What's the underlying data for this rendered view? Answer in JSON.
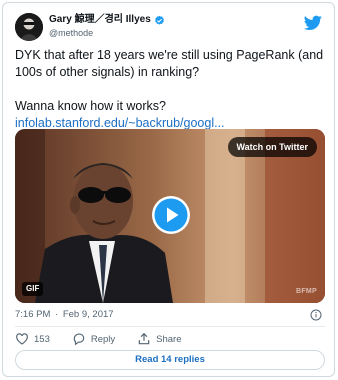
{
  "author": {
    "name": "Gary 鯨理／경리 Illyes",
    "handle": "@methode",
    "verified_color": "#1d9bf0"
  },
  "platform_icon": "twitter-bird-icon",
  "tweet": {
    "line1": "DYK that after 18 years we're still using PageRank (and 100s of other signals) in ranking?",
    "line2": "Wanna know how it works?",
    "link": "infolab.stanford.edu/~backrub/googl..."
  },
  "media": {
    "watch_label": "Watch on Twitter",
    "gif_label": "GIF",
    "watermark": "BFMP",
    "play_icon": "play-icon",
    "play_color": "#1d9bf0"
  },
  "meta": {
    "time": "7:16 PM",
    "date": "Feb 9, 2017",
    "info_icon": "info-icon"
  },
  "actions": {
    "like_count": "153",
    "like_icon": "heart-icon",
    "reply_label": "Reply",
    "reply_icon": "reply-icon",
    "share_label": "Share",
    "share_icon": "share-icon"
  },
  "read_replies_label": "Read 14 replies",
  "link_color": "#1b6fc4"
}
